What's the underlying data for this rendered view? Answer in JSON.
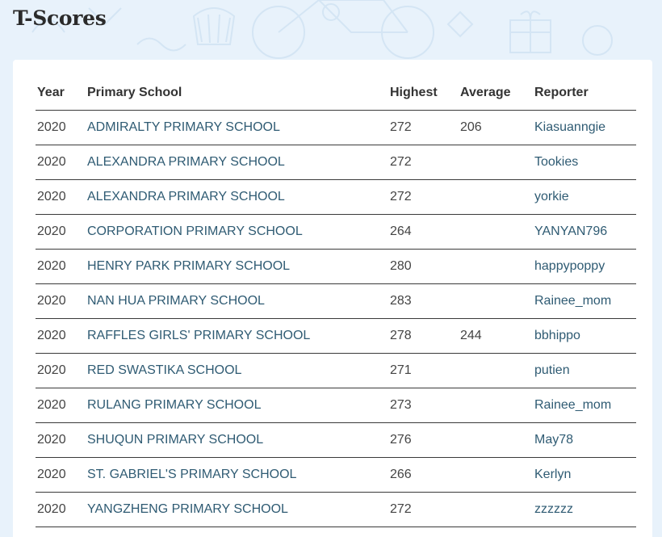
{
  "page": {
    "title": "T-Scores"
  },
  "table": {
    "headers": {
      "year": "Year",
      "school": "Primary School",
      "highest": "Highest",
      "average": "Average",
      "reporter": "Reporter"
    },
    "rows": [
      {
        "year": "2020",
        "school": "ADMIRALTY PRIMARY SCHOOL",
        "highest": "272",
        "average": "206",
        "reporter": "Kiasuanngie"
      },
      {
        "year": "2020",
        "school": "ALEXANDRA PRIMARY SCHOOL",
        "highest": "272",
        "average": "",
        "reporter": "Tookies"
      },
      {
        "year": "2020",
        "school": "ALEXANDRA PRIMARY SCHOOL",
        "highest": "272",
        "average": "",
        "reporter": "yorkie"
      },
      {
        "year": "2020",
        "school": "CORPORATION PRIMARY SCHOOL",
        "highest": "264",
        "average": "",
        "reporter": "YANYAN796"
      },
      {
        "year": "2020",
        "school": "HENRY PARK PRIMARY SCHOOL",
        "highest": "280",
        "average": "",
        "reporter": "happypoppy"
      },
      {
        "year": "2020",
        "school": "NAN HUA PRIMARY SCHOOL",
        "highest": "283",
        "average": "",
        "reporter": "Rainee_mom"
      },
      {
        "year": "2020",
        "school": "RAFFLES GIRLS' PRIMARY SCHOOL",
        "highest": "278",
        "average": "244",
        "reporter": "bbhippo"
      },
      {
        "year": "2020",
        "school": "RED SWASTIKA SCHOOL",
        "highest": "271",
        "average": "",
        "reporter": "putien"
      },
      {
        "year": "2020",
        "school": "RULANG PRIMARY SCHOOL",
        "highest": "273",
        "average": "",
        "reporter": "Rainee_mom"
      },
      {
        "year": "2020",
        "school": "SHUQUN PRIMARY SCHOOL",
        "highest": "276",
        "average": "",
        "reporter": "May78"
      },
      {
        "year": "2020",
        "school": "ST. GABRIEL'S PRIMARY SCHOOL",
        "highest": "266",
        "average": "",
        "reporter": "Kerlyn"
      },
      {
        "year": "2020",
        "school": "YANGZHENG PRIMARY SCHOOL",
        "highest": "272",
        "average": "",
        "reporter": "zzzzzz"
      }
    ]
  },
  "colors": {
    "background": "#e8f2fb",
    "card": "#ffffff",
    "link": "#2f5b73",
    "text": "#444444",
    "heading": "#2b2b2b"
  }
}
